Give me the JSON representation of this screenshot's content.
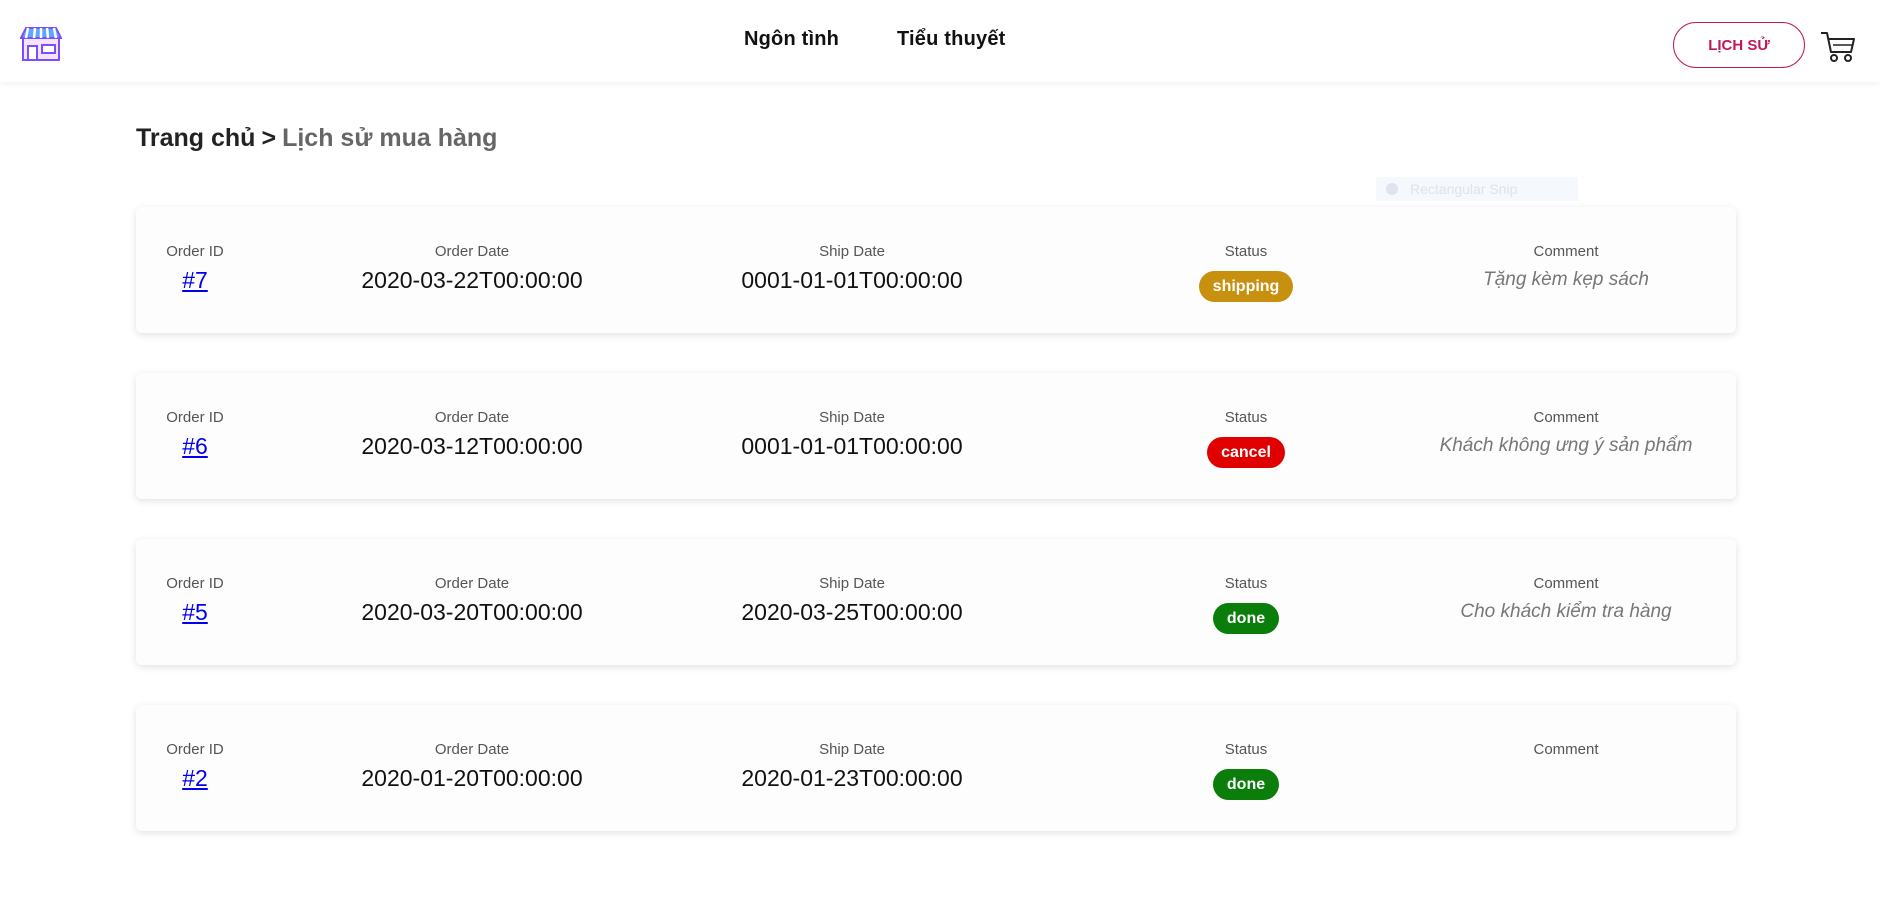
{
  "header": {
    "nav": [
      "Ngôn tình",
      "Tiểu thuyết"
    ],
    "history_button": "LỊCH SỬ",
    "logo_icon": "shop-icon",
    "cart_icon": "cart-icon"
  },
  "breadcrumb": {
    "home": "Trang chủ",
    "separator": ">",
    "current": "Lịch sử mua hàng"
  },
  "overlay": {
    "snip_label": "Rectangular Snip"
  },
  "labels": {
    "order_id": "Order ID",
    "order_date": "Order Date",
    "ship_date": "Ship Date",
    "status": "Status",
    "comment": "Comment"
  },
  "status_colors": {
    "shipping": "#c8900f",
    "cancel": "#e00000",
    "done": "#0a7d0a"
  },
  "orders": [
    {
      "id": "#7",
      "order_date": "2020-03-22T00:00:00",
      "ship_date": "0001-01-01T00:00:00",
      "status": "shipping",
      "comment": "Tặng kèm kẹp sách"
    },
    {
      "id": "#6",
      "order_date": "2020-03-12T00:00:00",
      "ship_date": "0001-01-01T00:00:00",
      "status": "cancel",
      "comment": "Khách không ưng ý sản phẩm"
    },
    {
      "id": "#5",
      "order_date": "2020-03-20T00:00:00",
      "ship_date": "2020-03-25T00:00:00",
      "status": "done",
      "comment": "Cho khách kiểm tra hàng"
    },
    {
      "id": "#2",
      "order_date": "2020-01-20T00:00:00",
      "ship_date": "2020-01-23T00:00:00",
      "status": "done",
      "comment": ""
    }
  ]
}
